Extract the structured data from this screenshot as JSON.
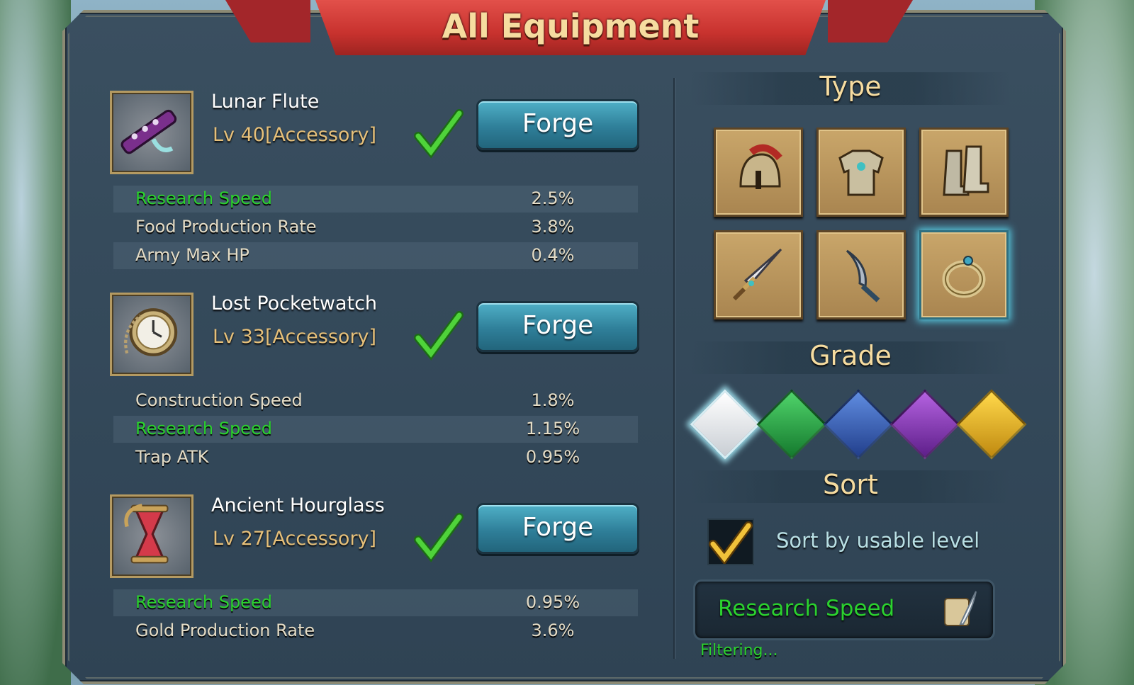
{
  "window": {
    "title": "All Equipment"
  },
  "equipment": [
    {
      "name": "Lunar Flute",
      "level": "Lv 40[Accessory]",
      "icon": "lunar-flute-icon",
      "button": "Forge",
      "stats": [
        {
          "label": "Research Speed",
          "value": "2.5%",
          "highlight": true
        },
        {
          "label": "Food Production Rate",
          "value": "3.8%",
          "highlight": false
        },
        {
          "label": "Army Max HP",
          "value": "0.4%",
          "highlight": false
        }
      ]
    },
    {
      "name": "Lost Pocketwatch",
      "level": "Lv 33[Accessory]",
      "icon": "pocketwatch-icon",
      "button": "Forge",
      "stats": [
        {
          "label": "Construction Speed",
          "value": "1.8%",
          "highlight": false
        },
        {
          "label": "Research Speed",
          "value": "1.15%",
          "highlight": true
        },
        {
          "label": "Trap ATK",
          "value": "0.95%",
          "highlight": false
        }
      ]
    },
    {
      "name": "Ancient Hourglass",
      "level": "Lv 27[Accessory]",
      "icon": "hourglass-icon",
      "button": "Forge",
      "stats": [
        {
          "label": "Research Speed",
          "value": "0.95%",
          "highlight": true
        },
        {
          "label": "Gold Production Rate",
          "value": "3.6%",
          "highlight": false
        }
      ]
    }
  ],
  "filters": {
    "type_title": "Type",
    "types": [
      {
        "name": "helmet",
        "selected": false
      },
      {
        "name": "armor",
        "selected": false
      },
      {
        "name": "boots",
        "selected": false
      },
      {
        "name": "main-hand",
        "selected": false
      },
      {
        "name": "off-hand",
        "selected": false
      },
      {
        "name": "accessory",
        "selected": true
      }
    ],
    "grade_title": "Grade",
    "grades": [
      {
        "name": "white",
        "color": "#e6e9ec",
        "selected": true
      },
      {
        "name": "green",
        "color": "#1e9a3a",
        "selected": false
      },
      {
        "name": "blue",
        "color": "#2f5fb8",
        "selected": false
      },
      {
        "name": "purple",
        "color": "#8a35b8",
        "selected": false
      },
      {
        "name": "gold",
        "color": "#e0b01c",
        "selected": false
      }
    ],
    "sort_title": "Sort",
    "sort_label": "Sort by usable level",
    "sort_checked": true,
    "attribute_filter": "Research Speed",
    "status": "Filtering..."
  },
  "colors": {
    "highlight_stat": "#2bd12f",
    "normal_stat": "#e4dcc6",
    "title_gold": "#f6dca0",
    "forge_button": "#2f7f99"
  }
}
